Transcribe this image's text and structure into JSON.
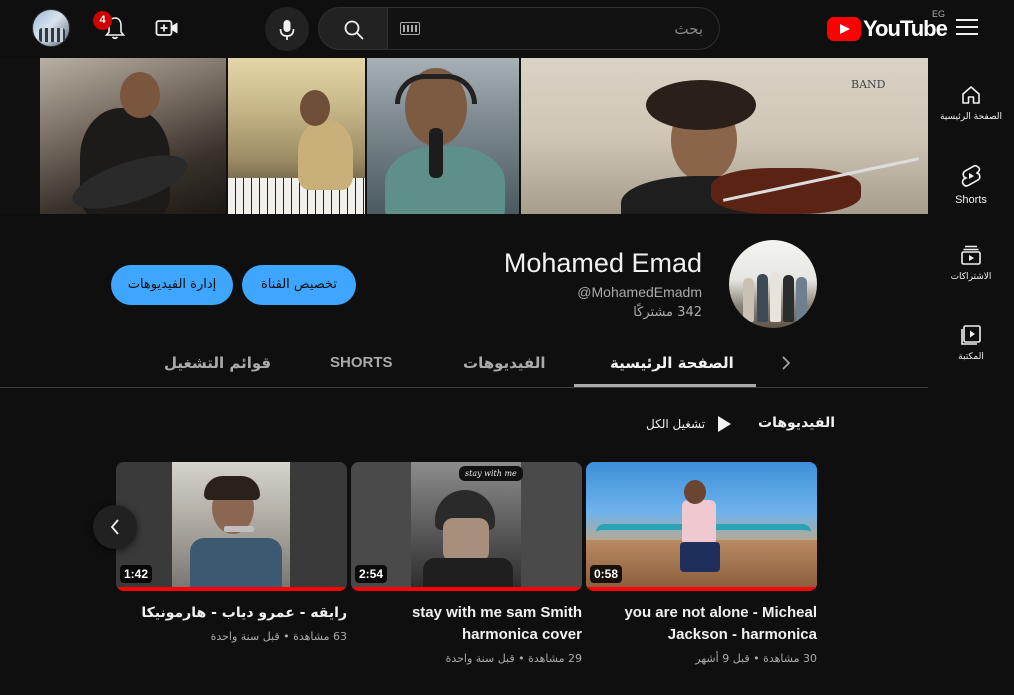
{
  "topbar": {
    "notification_count": "4",
    "search": {
      "placeholder": "بحث"
    },
    "logo_text": "YouTube",
    "country_code": "EG"
  },
  "guide": {
    "items": [
      {
        "label": "الصفحة الرئيسية",
        "icon": "home-icon"
      },
      {
        "label": "Shorts",
        "icon": "shorts-icon"
      },
      {
        "label": "الاشتراكات",
        "icon": "subscriptions-icon"
      },
      {
        "label": "المكتبة",
        "icon": "library-icon"
      }
    ]
  },
  "channel": {
    "name": "Mohamed Emad",
    "handle": "@MohamedEmadm",
    "subscribers": "342 مشتركًا",
    "customize_label": "تخصيص القناة",
    "manage_label": "إدارة الفيديوهات"
  },
  "tabs": [
    {
      "label": "الصفحة الرئيسية",
      "active": true
    },
    {
      "label": "الفيديوهات",
      "active": false
    },
    {
      "label": "SHORTS",
      "active": false
    },
    {
      "label": "قوائم التشغيل",
      "active": false
    }
  ],
  "section": {
    "title": "الفيديوهات",
    "play_all_label": "تشغيل الكل"
  },
  "videos": [
    {
      "title": "you are not alone - Micheal Jackson - harmonica",
      "duration": "0:58",
      "views": "30 مشاهدة",
      "age": "قبل 9 أشهر"
    },
    {
      "title": "stay with me sam Smith harmonica cover",
      "duration": "2:54",
      "views": "29 مشاهدة",
      "age": "قبل سنة واحدة"
    },
    {
      "title": "رايقه - عمرو دياب - هارمونيكا",
      "duration": "1:42",
      "views": "63 مشاهدة",
      "age": "قبل سنة واحدة"
    }
  ],
  "thumbnail_overlay_text": "stay with me",
  "colors": {
    "accent_blue": "#3ea6ff",
    "brand_red": "#ff0000",
    "background": "#0f0f0f"
  }
}
